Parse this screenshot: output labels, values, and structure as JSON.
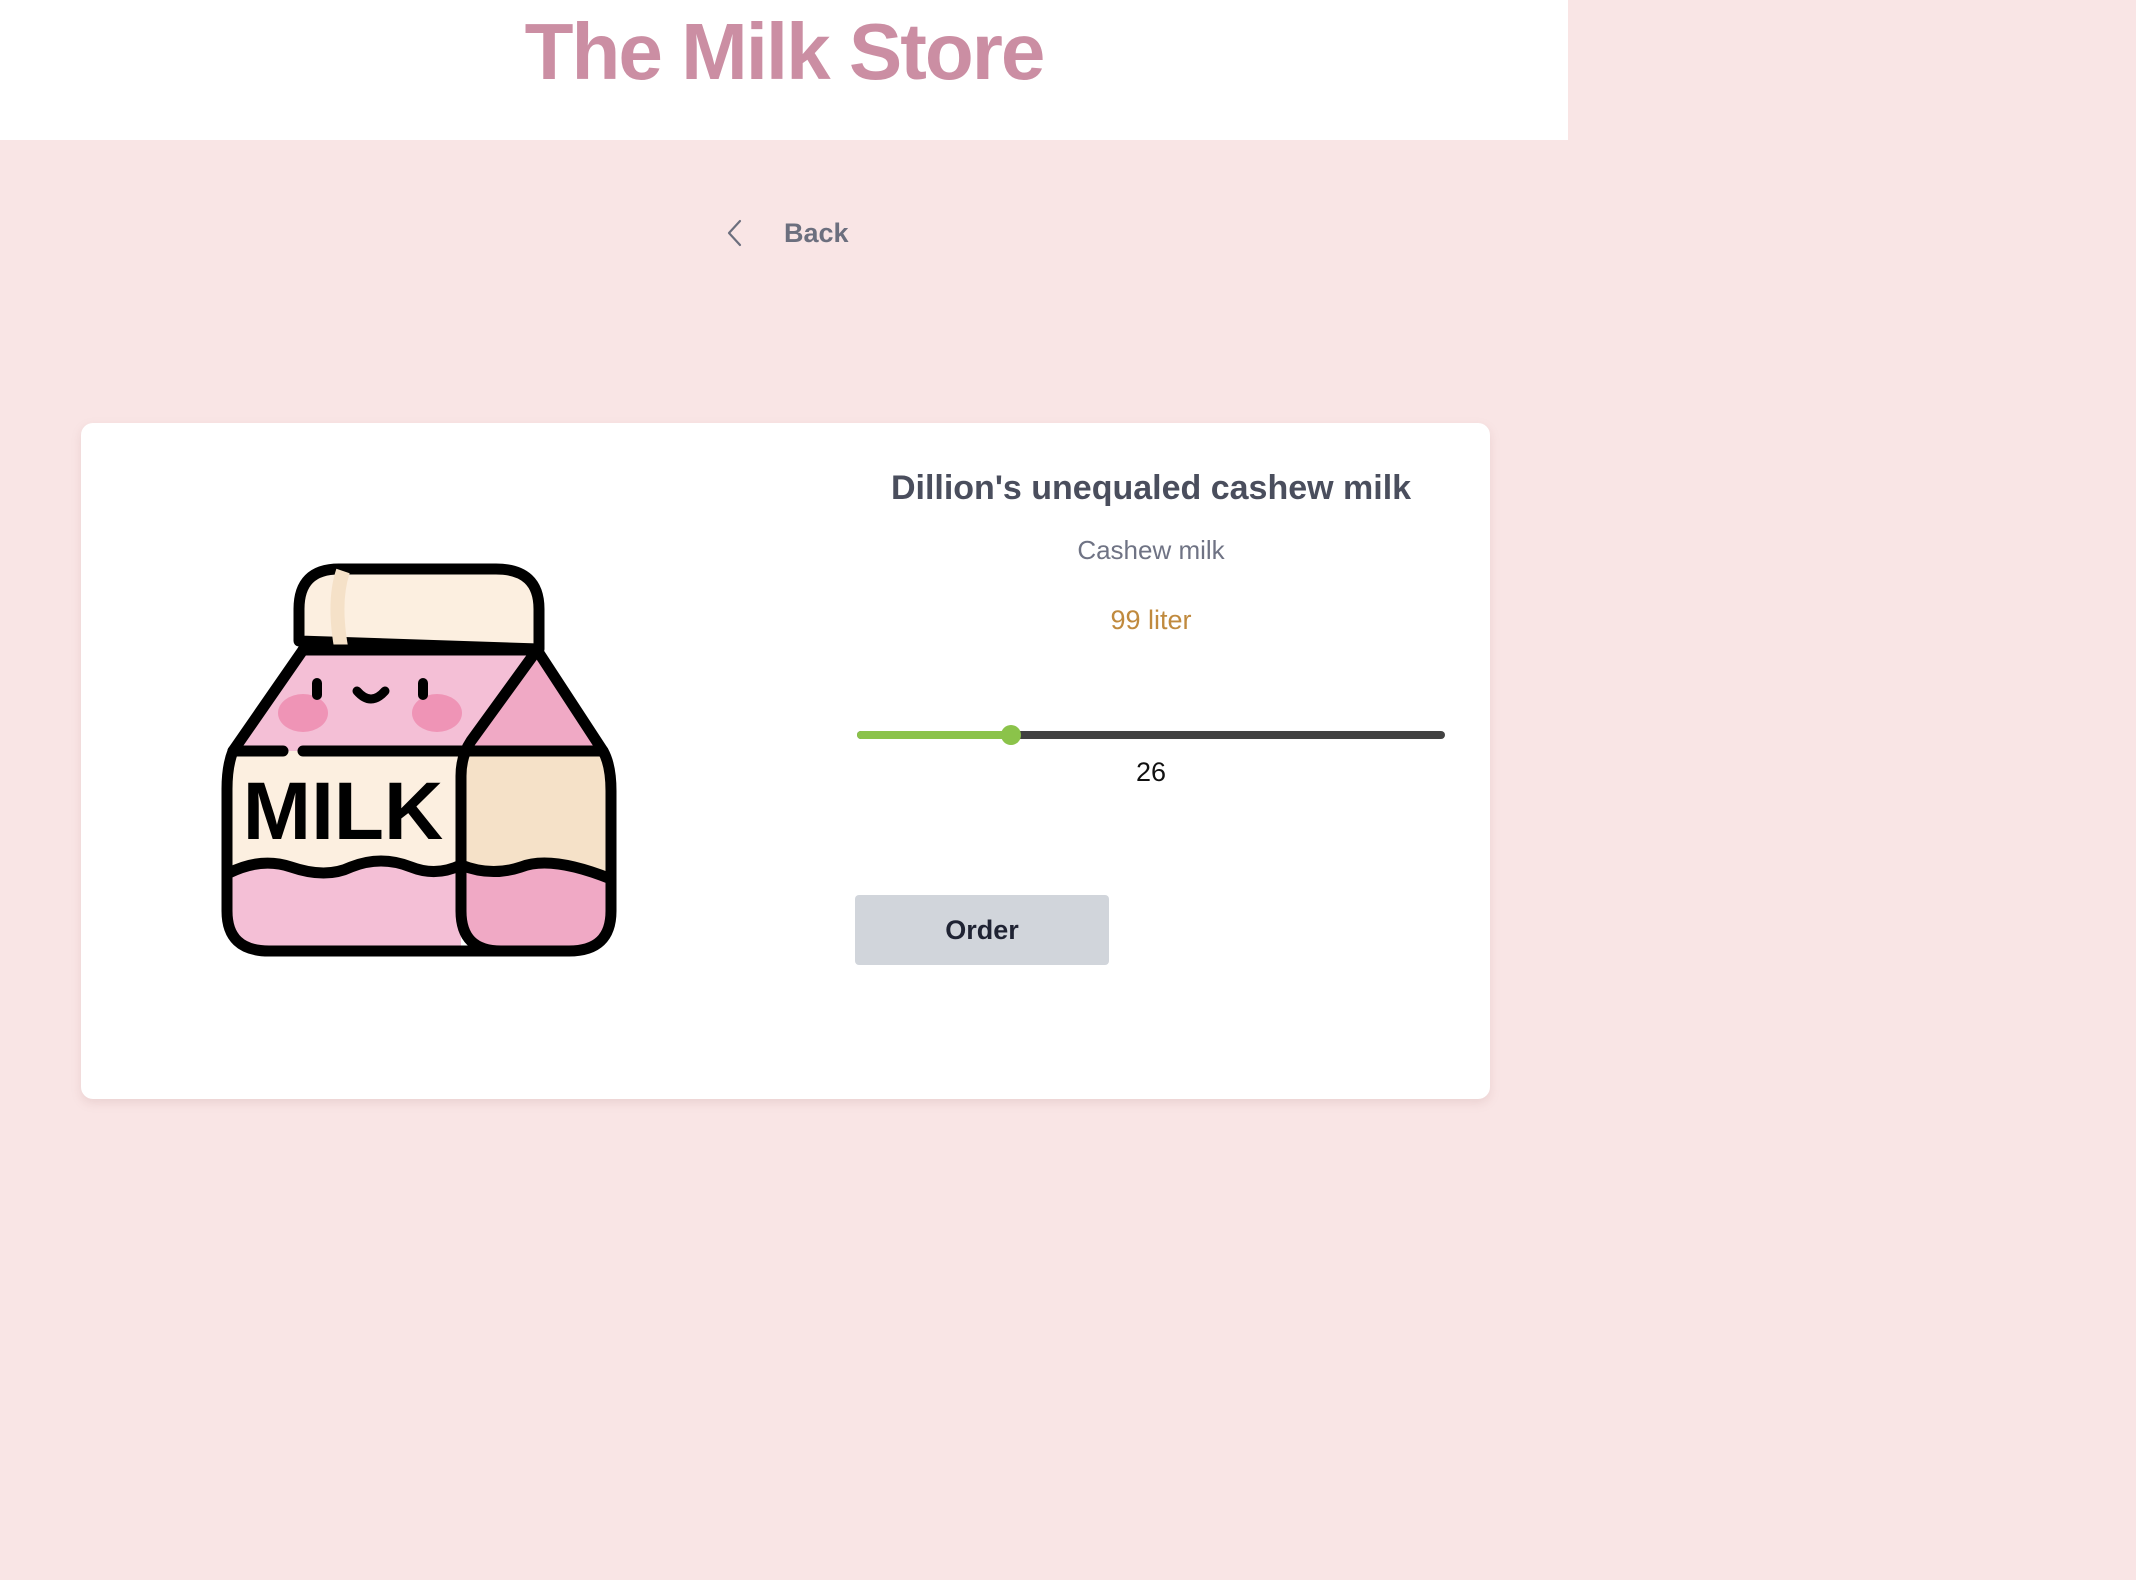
{
  "header": {
    "title": "The Milk Store"
  },
  "nav": {
    "back_label": "Back"
  },
  "product": {
    "name": "Dillion's unequaled cashew milk",
    "type": "Cashew milk",
    "amount": "99 liter",
    "image_label": "MILK"
  },
  "quantity": {
    "value": "26",
    "min": 0,
    "max": 99
  },
  "actions": {
    "order_label": "Order"
  },
  "colors": {
    "title": "#cb8ea3",
    "background": "#f9e5e5",
    "accent": "#8bc34a",
    "amount": "#c08a3e",
    "button": "#d1d5db"
  }
}
